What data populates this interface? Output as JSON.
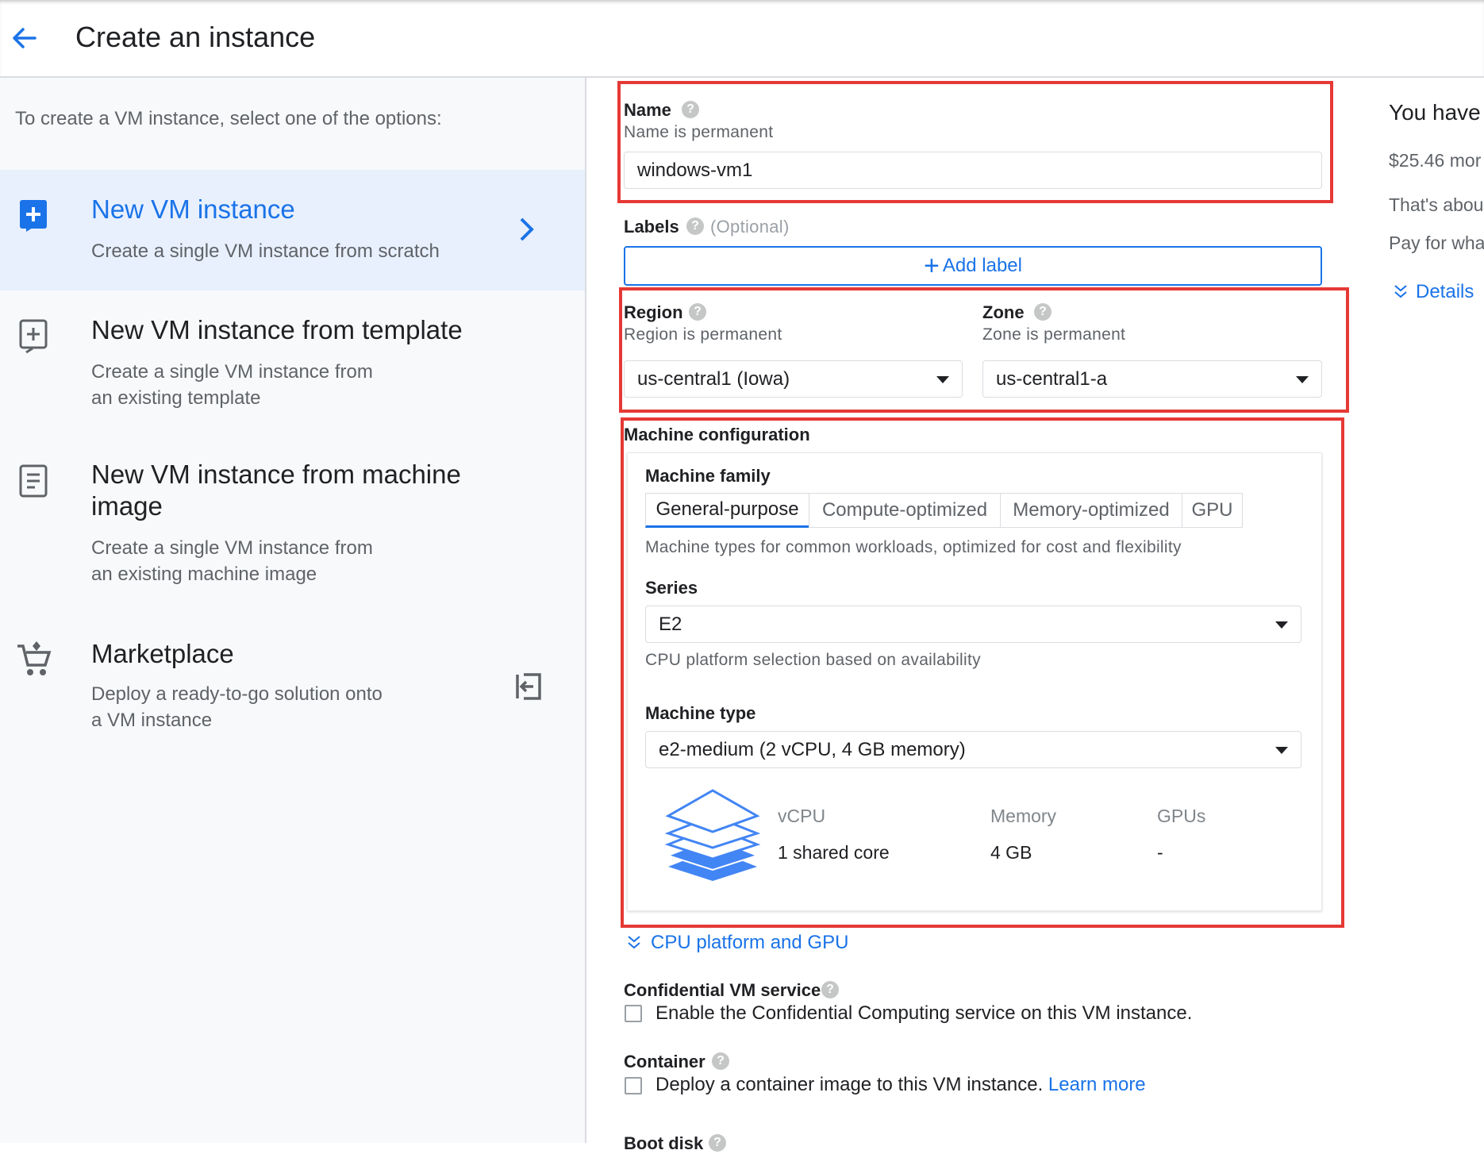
{
  "header": {
    "title": "Create an instance"
  },
  "left": {
    "intro": "To create a VM instance, select one of the options:",
    "options": [
      {
        "title": "New VM instance",
        "desc": "Create a single VM instance from scratch"
      },
      {
        "title": "New VM instance from template",
        "desc_line1": "Create a single VM instance from",
        "desc_line2": "an existing template"
      },
      {
        "title_line1": "New VM instance from machine",
        "title_line2": "image",
        "desc_line1": "Create a single VM instance from",
        "desc_line2": "an existing machine image"
      },
      {
        "title": "Marketplace",
        "desc_line1": "Deploy a ready-to-go solution onto",
        "desc_line2": "a VM instance"
      }
    ]
  },
  "form": {
    "name": {
      "label": "Name",
      "sub": "Name is permanent",
      "value": "windows-vm1"
    },
    "labels": {
      "label": "Labels",
      "optional": "(Optional)",
      "add_button": "Add label"
    },
    "region": {
      "label": "Region",
      "sub": "Region is permanent",
      "value": "us-central1 (Iowa)"
    },
    "zone": {
      "label": "Zone",
      "sub": "Zone is permanent",
      "value": "us-central1-a"
    },
    "machine": {
      "title": "Machine configuration",
      "family_label": "Machine family",
      "tabs": [
        "General-purpose",
        "Compute-optimized",
        "Memory-optimized",
        "GPU"
      ],
      "family_desc": "Machine types for common workloads, optimized for cost and flexibility",
      "series_label": "Series",
      "series_value": "E2",
      "series_desc": "CPU platform selection based on availability",
      "type_label": "Machine type",
      "type_value": "e2-medium (2 vCPU, 4 GB memory)",
      "specs": {
        "vcpu_header": "vCPU",
        "vcpu_value": "1 shared core",
        "memory_header": "Memory",
        "memory_value": "4 GB",
        "gpus_header": "GPUs",
        "gpus_value": "-"
      }
    },
    "cpu_gpu_link": "CPU platform and GPU",
    "confidential": {
      "label": "Confidential VM service",
      "checkbox": "Enable the Confidential Computing service on this VM instance."
    },
    "container": {
      "label": "Container",
      "checkbox": "Deploy a container image to this VM instance.",
      "learn_more": "Learn more"
    },
    "boot_disk_label": "Boot disk"
  },
  "right": {
    "title": "You have",
    "price": "$25.46 mor",
    "line1": "That's abou",
    "line2": "Pay for wha",
    "details": "Details"
  },
  "colors": {
    "accent": "#1a73e8",
    "highlight": "#e53935",
    "selected_bg": "#e8f0fe"
  }
}
